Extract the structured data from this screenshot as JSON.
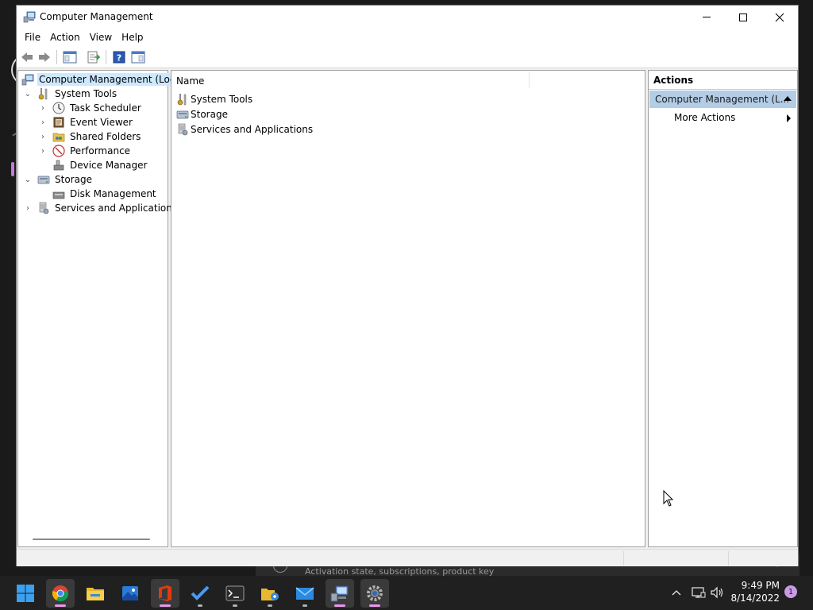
{
  "window": {
    "title": "Computer Management",
    "menu": [
      "File",
      "Action",
      "View",
      "Help"
    ]
  },
  "tree": {
    "items": [
      {
        "label": "Computer Management (Local",
        "level": 0,
        "expander": "",
        "icon": "computer-management-icon",
        "selected": true
      },
      {
        "label": "System Tools",
        "level": 1,
        "expander": "expanded",
        "icon": "system-tools-icon"
      },
      {
        "label": "Task Scheduler",
        "level": 2,
        "expander": "collapsed",
        "icon": "clock-icon"
      },
      {
        "label": "Event Viewer",
        "level": 2,
        "expander": "collapsed",
        "icon": "event-viewer-icon"
      },
      {
        "label": "Shared Folders",
        "level": 2,
        "expander": "collapsed",
        "icon": "shared-folders-icon"
      },
      {
        "label": "Performance",
        "level": 2,
        "expander": "collapsed",
        "icon": "performance-icon"
      },
      {
        "label": "Device Manager",
        "level": 2,
        "expander": "",
        "icon": "device-manager-icon"
      },
      {
        "label": "Storage",
        "level": 1,
        "expander": "expanded",
        "icon": "storage-icon"
      },
      {
        "label": "Disk Management",
        "level": 2,
        "expander": "",
        "icon": "disk-management-icon"
      },
      {
        "label": "Services and Applications",
        "level": 1,
        "expander": "collapsed",
        "icon": "services-applications-icon"
      }
    ]
  },
  "list": {
    "column_name": "Name",
    "rows": [
      {
        "label": "System Tools",
        "icon": "system-tools-icon"
      },
      {
        "label": "Storage",
        "icon": "storage-icon"
      },
      {
        "label": "Services and Applications",
        "icon": "services-applications-icon"
      }
    ]
  },
  "actions": {
    "header": "Actions",
    "section": "Computer Management (L...",
    "item": "More Actions"
  },
  "behind_window_text": "Activation state, subscriptions, product key",
  "taskbar": {
    "apps": [
      "start-icon",
      "chrome-icon",
      "file-explorer-icon",
      "photos-icon",
      "office-icon",
      "todo-icon",
      "terminal-icon",
      "file-share-icon",
      "mail-icon",
      "computer-management-icon",
      "settings-icon"
    ],
    "time": "9:49 PM",
    "date": "8/14/2022",
    "notification_count": "1"
  }
}
